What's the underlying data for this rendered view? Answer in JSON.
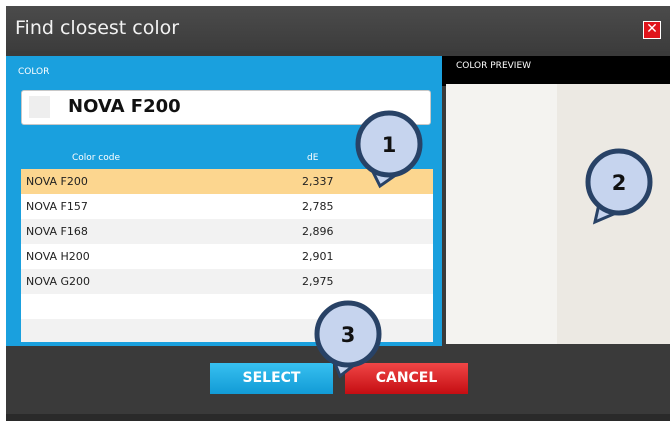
{
  "dialog": {
    "title": "Find closest color",
    "close_label": "✕"
  },
  "color_panel": {
    "label": "COLOR",
    "value": "NOVA F200"
  },
  "table": {
    "headers": {
      "code": "Color code",
      "de": "dE"
    },
    "rows": [
      {
        "code": "NOVA F200",
        "de": "2,337",
        "selected": true
      },
      {
        "code": "NOVA F157",
        "de": "2,785"
      },
      {
        "code": "NOVA F168",
        "de": "2,896"
      },
      {
        "code": "NOVA H200",
        "de": "2,901"
      },
      {
        "code": "NOVA G200",
        "de": "2,975"
      }
    ]
  },
  "preview": {
    "label": "COLOR PREVIEW"
  },
  "buttons": {
    "select": "SELECT",
    "cancel": "CANCEL"
  },
  "callouts": [
    "1",
    "2",
    "3"
  ],
  "colors": {
    "accent_blue": "#1aa0de",
    "selected_row": "#fcd68f",
    "cancel_red": "#e0141b",
    "callout_fill": "#c6d4ee",
    "callout_border": "#284266"
  }
}
